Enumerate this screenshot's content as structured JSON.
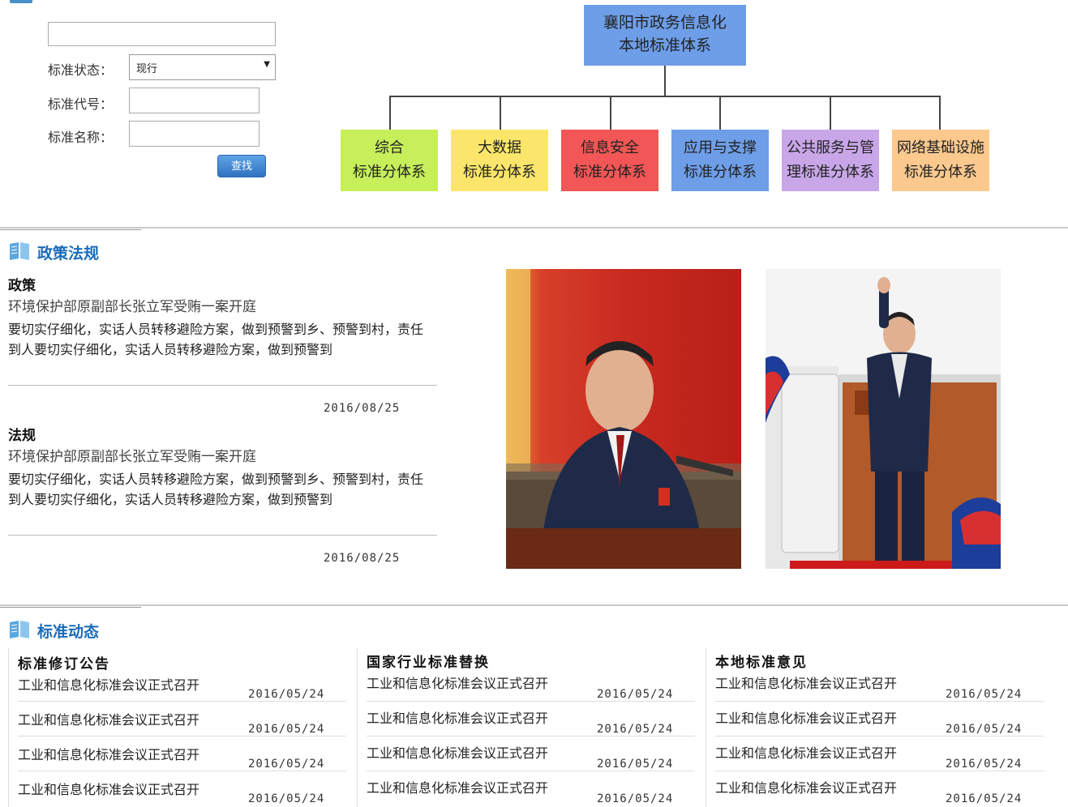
{
  "search": {
    "keyword_value": "",
    "status_label": "标准状态：",
    "status_value": "现行",
    "code_label": "标准代号：",
    "code_value": "",
    "name_label": "标准名称：",
    "name_value": "",
    "search_button": "查找"
  },
  "org_chart": {
    "root_line1": "襄阳市政务信息化",
    "root_line2": "本地标准体系",
    "children": [
      {
        "line1": "综合",
        "line2": "标准分体系",
        "color": "#c6ef5a"
      },
      {
        "line1": "大数据",
        "line2": "标准分体系",
        "color": "#fbe66b"
      },
      {
        "line1": "信息安全",
        "line2": "标准分体系",
        "color": "#f25656"
      },
      {
        "line1": "应用与支撑",
        "line2": "标准分体系",
        "color": "#6e9ee8"
      },
      {
        "line1": "公共服务与管",
        "line2": "理标准分体系",
        "color": "#c8a6e8"
      },
      {
        "line1": "网络基础设施",
        "line2": "标准分体系",
        "color": "#fbc98e"
      }
    ]
  },
  "policy": {
    "section_title": "政策法规",
    "items": [
      {
        "category": "政策",
        "title": "环境保护部原副部长张立军受贿一案开庭",
        "body": "要切实仔细化，实话人员转移避险方案，做到预警到乡、预警到村，责任到人要切实仔细化，实话人员转移避险方案，做到预警到",
        "date": "2016/08/25"
      },
      {
        "category": "法规",
        "title": "环境保护部原副部长张立军受贿一案开庭",
        "body": "要切实仔细化，实话人员转移避险方案，做到预警到乡、预警到村，责任到人要切实仔细化，实话人员转移避险方案，做到预警到",
        "date": "2016/08/25"
      }
    ]
  },
  "standards": {
    "section_title": "标准动态",
    "columns": [
      {
        "heading": "标准修订公告",
        "items": [
          {
            "title": "工业和信息化标准会议正式召开",
            "date": "2016/05/24"
          },
          {
            "title": "工业和信息化标准会议正式召开",
            "date": "2016/05/24"
          },
          {
            "title": "工业和信息化标准会议正式召开",
            "date": "2016/05/24"
          },
          {
            "title": "工业和信息化标准会议正式召开",
            "date": "2016/05/24"
          }
        ]
      },
      {
        "heading": "国家行业标准替换",
        "items": [
          {
            "title": "工业和信息化标准会议正式召开",
            "date": "2016/05/24"
          },
          {
            "title": "工业和信息化标准会议正式召开",
            "date": "2016/05/24"
          },
          {
            "title": "工业和信息化标准会议正式召开",
            "date": "2016/05/24"
          },
          {
            "title": "工业和信息化标准会议正式召开",
            "date": "2016/05/24"
          }
        ]
      },
      {
        "heading": "本地标准意见",
        "items": [
          {
            "title": "工业和信息化标准会议正式召开",
            "date": "2016/05/24"
          },
          {
            "title": "工业和信息化标准会议正式召开",
            "date": "2016/05/24"
          },
          {
            "title": "工业和信息化标准会议正式召开",
            "date": "2016/05/24"
          },
          {
            "title": "工业和信息化标准会议正式召开",
            "date": "2016/05/24"
          }
        ]
      }
    ]
  }
}
